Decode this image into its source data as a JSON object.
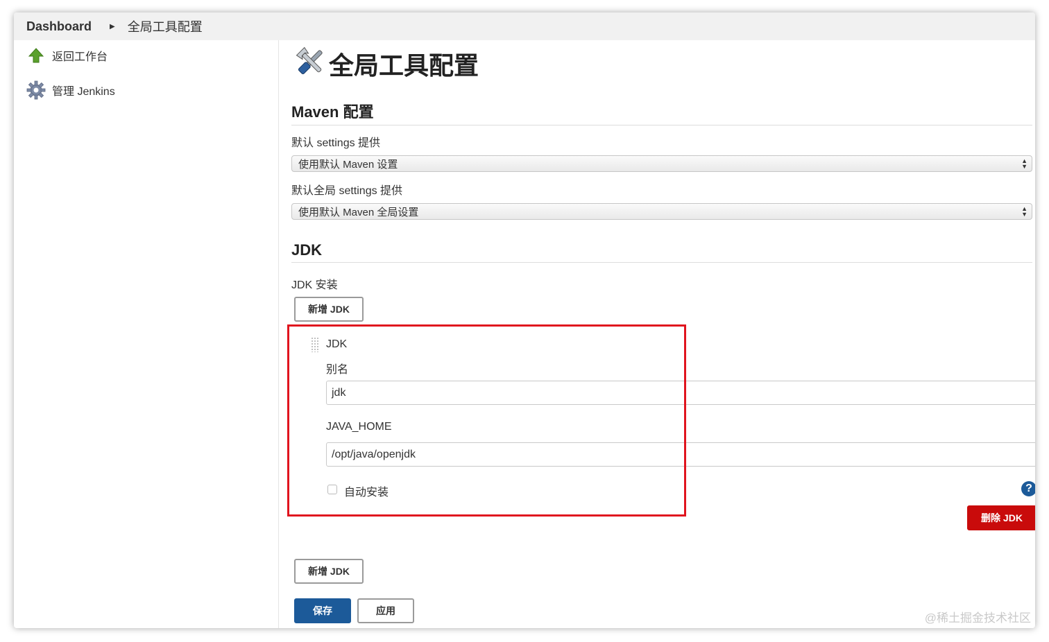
{
  "breadcrumb": {
    "home": "Dashboard",
    "current": "全局工具配置"
  },
  "sidebar": {
    "items": [
      {
        "label": "返回工作台",
        "icon": "up-arrow-icon"
      },
      {
        "label": "管理 Jenkins",
        "icon": "gear-icon"
      }
    ]
  },
  "page": {
    "title": "全局工具配置",
    "title_icon": "tools-icon"
  },
  "maven": {
    "section_title": "Maven 配置",
    "settings_label": "默认 settings 提供",
    "settings_value": "使用默认 Maven 设置",
    "global_settings_label": "默认全局 settings 提供",
    "global_settings_value": "使用默认 Maven 全局设置"
  },
  "jdk": {
    "section_title": "JDK",
    "install_label": "JDK 安装",
    "add_button": "新增 JDK",
    "entry": {
      "header": "JDK",
      "name_label": "别名",
      "name_value": "jdk",
      "home_label": "JAVA_HOME",
      "home_value": "/opt/java/openjdk",
      "auto_install_label": "自动安装",
      "auto_install_checked": false,
      "delete_button": "删除 JDK"
    },
    "add_button_bottom": "新增 JDK"
  },
  "actions": {
    "save": "保存",
    "apply": "应用"
  },
  "watermark": "@稀土掘金技术社区",
  "colors": {
    "primary": "#1c5a99",
    "danger": "#c90b0b",
    "highlight": "#e0141e"
  }
}
